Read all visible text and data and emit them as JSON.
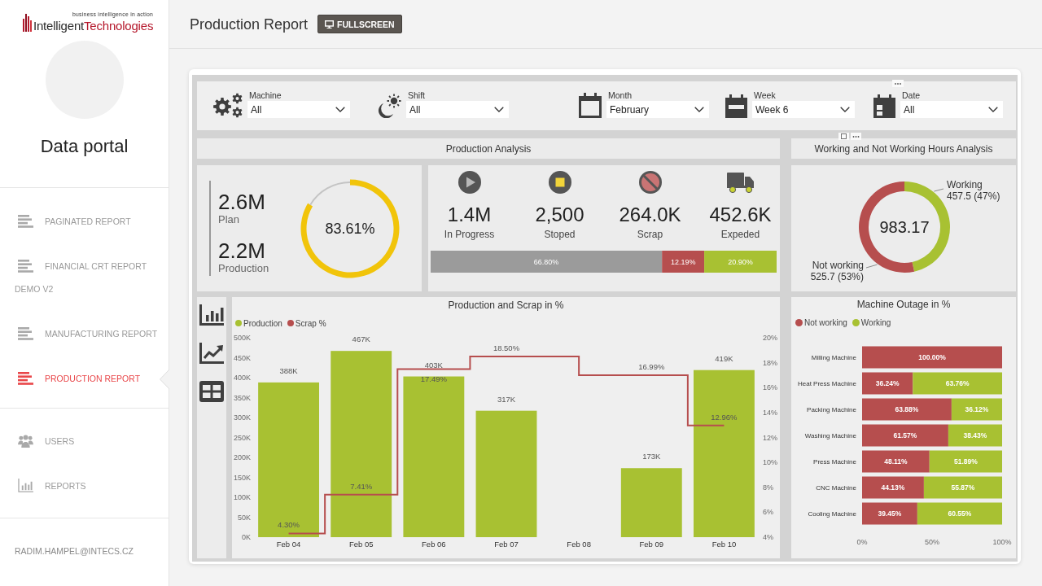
{
  "sidebar": {
    "logo": {
      "tagline": "business intelligence in action",
      "words": [
        "Intelligent",
        "Technologies"
      ]
    },
    "title": "Data portal",
    "nav_groups": [
      {
        "items": [
          {
            "label": "PAGINATED REPORT",
            "kind": "report",
            "selected": false
          },
          {
            "label": "FINANCIAL CRT REPORT DEMO V2",
            "kind": "report",
            "selected": false
          },
          {
            "label": "MANUFACTURING REPORT",
            "kind": "report",
            "selected": false
          },
          {
            "label": "PRODUCTION REPORT",
            "kind": "report",
            "selected": true
          }
        ]
      },
      {
        "items": [
          {
            "label": "USERS",
            "kind": "users",
            "selected": false
          },
          {
            "label": "REPORTS",
            "kind": "reports",
            "selected": false
          }
        ]
      }
    ],
    "user_email": "RADIM.HAMPEL@INTECS.CZ"
  },
  "header": {
    "title": "Production Report",
    "fullscreen_button": "FULLSCREEN"
  },
  "report": {
    "filters": [
      {
        "label": "Machine",
        "value": "All",
        "kind": "machine"
      },
      {
        "label": "Shift",
        "value": "All",
        "kind": "shift"
      },
      {
        "label": "Month",
        "value": "February",
        "kind": "month"
      },
      {
        "label": "Week",
        "value": "Week 6",
        "kind": "week"
      },
      {
        "label": "Date",
        "value": "All",
        "kind": "date"
      }
    ],
    "production_analysis": {
      "title": "Production Analysis",
      "totals": [
        {
          "value": "2.6M",
          "label": "Plan"
        },
        {
          "value": "2.2M",
          "label": "Production"
        }
      ],
      "gauge": {
        "chart_data": {
          "type": "donut",
          "values": [
            83.61,
            16.39
          ],
          "colors": [
            "#f1c40a",
            "#c4c4c4"
          ],
          "annotations": [
            "83.61%"
          ]
        }
      },
      "statuses": [
        {
          "value": "1.4M",
          "label": "In Progress",
          "kind": "in_progress"
        },
        {
          "value": "2,500",
          "label": "Stoped",
          "kind": "stopped"
        },
        {
          "value": "264.0K",
          "label": "Scrap",
          "kind": "scrap"
        },
        {
          "value": "452.6K",
          "label": "Expeded",
          "kind": "expedited"
        }
      ],
      "share_bar": {
        "chart_data": {
          "type": "bar",
          "orientation": "horizontal",
          "stacked": true,
          "series": [
            {
              "color": "#9b9b9b",
              "values": [
                66.8
              ],
              "value_labels": [
                "66.80%"
              ]
            },
            {
              "color": "#b64e4e",
              "values": [
                12.19
              ],
              "value_labels": [
                "12.19%"
              ]
            },
            {
              "color": "#a8c132",
              "values": [
                20.9
              ],
              "value_labels": [
                "20.90%"
              ]
            }
          ]
        }
      }
    },
    "hours_analysis": {
      "title": "Working and Not Working Hours Analysis",
      "chart_data": {
        "type": "donut",
        "categories": [
          "Working",
          "Not working"
        ],
        "values": [
          457.5,
          525.7
        ],
        "colors": [
          "#a8c132",
          "#b64e4e"
        ],
        "value_labels": [
          "457.5 (47%)",
          "525.7 (53%)"
        ],
        "annotations": [
          "983.17"
        ]
      }
    },
    "production_scrap": {
      "chart_data": {
        "type": "bar",
        "title": "Production and Scrap in %",
        "legend": "top-left",
        "categories": [
          "Feb 04",
          "Feb 05",
          "Feb 06",
          "Feb 07",
          "Feb 08",
          "Feb 09",
          "Feb 10"
        ],
        "ylim": [
          0,
          500000
        ],
        "yticks": [
          {
            "value": 0,
            "label": "0K"
          },
          {
            "value": 50000,
            "label": "50K"
          },
          {
            "value": 100000,
            "label": "100K"
          },
          {
            "value": 150000,
            "label": "150K"
          },
          {
            "value": 200000,
            "label": "200K"
          },
          {
            "value": 250000,
            "label": "250K"
          },
          {
            "value": 300000,
            "label": "300K"
          },
          {
            "value": 350000,
            "label": "350K"
          },
          {
            "value": 400000,
            "label": "400K"
          },
          {
            "value": 450000,
            "label": "450K"
          },
          {
            "value": 500000,
            "label": "500K"
          }
        ],
        "y2lim": [
          4,
          20
        ],
        "y2ticks": [
          {
            "value": 4,
            "label": "4%"
          },
          {
            "value": 6,
            "label": "6%"
          },
          {
            "value": 8,
            "label": "8%"
          },
          {
            "value": 10,
            "label": "10%"
          },
          {
            "value": 12,
            "label": "12%"
          },
          {
            "value": 14,
            "label": "14%"
          },
          {
            "value": 16,
            "label": "16%"
          },
          {
            "value": 18,
            "label": "18%"
          },
          {
            "value": 20,
            "label": "20%"
          }
        ],
        "series": [
          {
            "name": "Production",
            "color": "#a8c132",
            "values": [
              388000,
              467000,
              403000,
              317000,
              null,
              173000,
              419000
            ],
            "value_labels": [
              "388K",
              "467K",
              "403K",
              "317K",
              null,
              "173K",
              "419K"
            ]
          },
          {
            "name": "Scrap %",
            "type": "step",
            "axis": "y2",
            "color": "#b64e4e",
            "values": [
              4.3,
              7.41,
              17.49,
              18.5,
              null,
              16.99,
              12.96
            ],
            "value_labels": [
              "4.30%",
              "7.41%",
              "17.49%",
              "18.50%",
              null,
              "16.99%",
              "12.96%"
            ]
          }
        ]
      }
    },
    "machine_outage": {
      "chart_data": {
        "type": "bar",
        "orientation": "horizontal",
        "stacked": true,
        "title": "Machine Outage in %",
        "legend": "top-left",
        "categories": [
          "Milling Machine",
          "Heat Press Machine",
          "Packing Machine",
          "Washing Machine",
          "Press Machine",
          "CNC Machine",
          "Cooling Machine"
        ],
        "xlim": [
          0,
          100
        ],
        "xticks": [
          {
            "value": 0,
            "label": "0%"
          },
          {
            "value": 50,
            "label": "50%"
          },
          {
            "value": 100,
            "label": "100%"
          }
        ],
        "series": [
          {
            "name": "Not working",
            "color": "#b64e4e",
            "values": [
              100,
              36.24,
              63.88,
              61.57,
              48.11,
              44.13,
              39.45
            ],
            "value_labels": [
              "100.00%",
              "36.24%",
              "63.88%",
              "61.57%",
              "48.11%",
              "44.13%",
              "39.45%"
            ]
          },
          {
            "name": "Working",
            "color": "#a8c132",
            "values": [
              null,
              63.76,
              36.12,
              38.43,
              51.89,
              55.87,
              60.55
            ],
            "value_labels": [
              null,
              "63.76%",
              "36.12%",
              "38.43%",
              "51.89%",
              "55.87%",
              "60.55%"
            ]
          }
        ]
      }
    }
  }
}
